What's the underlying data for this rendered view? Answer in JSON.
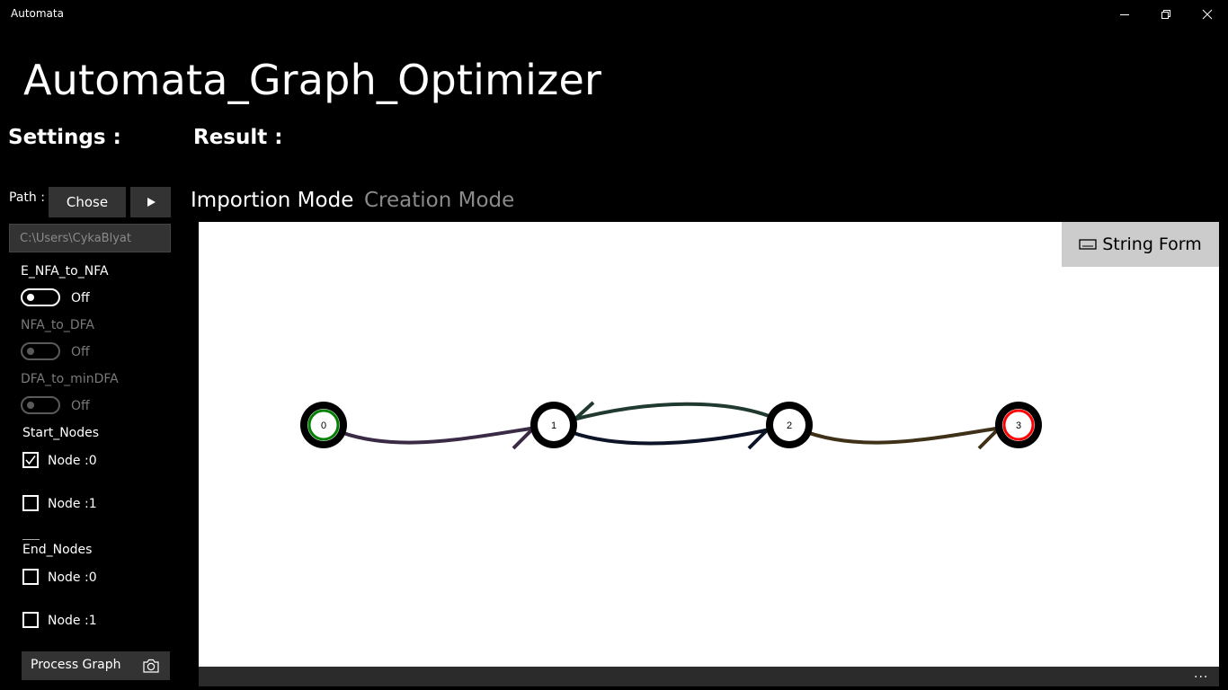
{
  "window": {
    "app_name": "Automata"
  },
  "header": {
    "title": "Automata_Graph_Optimizer",
    "settings_heading": "Settings :",
    "result_heading": "Result :"
  },
  "settings": {
    "path_label": "Path :",
    "chose_label": "Chose",
    "path_value": "C:\\Users\\CykaBlyat",
    "options": [
      {
        "label": "E_NFA_to_NFA",
        "state": "Off",
        "enabled": true
      },
      {
        "label": "NFA_to_DFA",
        "state": "Off",
        "enabled": false
      },
      {
        "label": "DFA_to_minDFA",
        "state": "Off",
        "enabled": false
      }
    ],
    "start_nodes_label": "Start_Nodes",
    "start_nodes": [
      {
        "label": "Node :0",
        "checked": true
      },
      {
        "label": "Node :1",
        "checked": false
      }
    ],
    "end_nodes_label": "End_Nodes",
    "end_nodes": [
      {
        "label": "Node :0",
        "checked": false
      },
      {
        "label": "Node :1",
        "checked": false
      }
    ],
    "process_label": "Process Graph"
  },
  "tabs": [
    {
      "label": "Importion Mode",
      "active": true
    },
    {
      "label": "Creation Mode",
      "active": false
    }
  ],
  "graph": {
    "string_form_label": "String Form",
    "nodes": [
      {
        "label": "0",
        "ring_color": "#008000",
        "role": "start"
      },
      {
        "label": "1",
        "ring_color": "#ffffff",
        "role": "normal"
      },
      {
        "label": "2",
        "ring_color": "#ffffff",
        "role": "normal"
      },
      {
        "label": "3",
        "ring_color": "#ff0000",
        "role": "end"
      }
    ],
    "edges": [
      {
        "from": "0",
        "to": "1",
        "color": "#3a2a45"
      },
      {
        "from": "1",
        "to": "2",
        "color": "#203a30"
      },
      {
        "from": "2",
        "to": "1",
        "color": "#0e1428"
      },
      {
        "from": "2",
        "to": "3",
        "color": "#3f3018"
      }
    ]
  },
  "footer": {
    "more_label": "..."
  }
}
